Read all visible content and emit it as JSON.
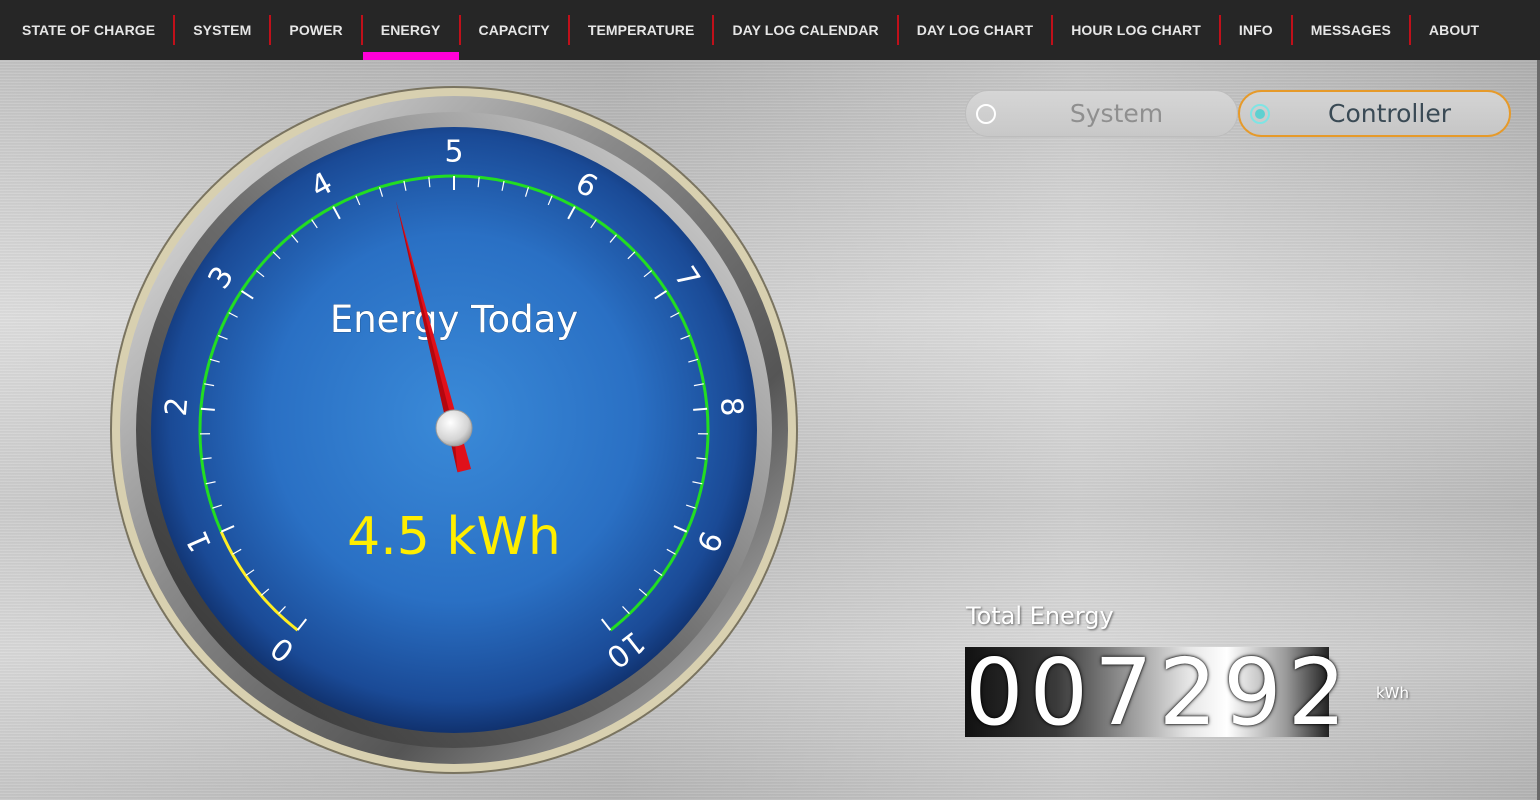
{
  "nav": {
    "tabs": [
      {
        "label": "STATE OF CHARGE"
      },
      {
        "label": "SYSTEM"
      },
      {
        "label": "POWER"
      },
      {
        "label": "ENERGY",
        "active": true
      },
      {
        "label": "CAPACITY"
      },
      {
        "label": "TEMPERATURE"
      },
      {
        "label": "DAY LOG CALENDAR"
      },
      {
        "label": "DAY LOG CHART"
      },
      {
        "label": "HOUR LOG CHART"
      },
      {
        "label": "INFO"
      },
      {
        "label": "MESSAGES"
      },
      {
        "label": "ABOUT"
      }
    ],
    "active_color": "#ff00d8",
    "separator_color": "#c0101a"
  },
  "toggle": {
    "system_label": "System",
    "controller_label": "Controller",
    "selected": "Controller"
  },
  "gauge": {
    "title": "Energy Today",
    "value_text": "4.5 kWh",
    "value": 4.5,
    "min": 0,
    "max": 10,
    "tick_labels": [
      "0",
      "1",
      "2",
      "3",
      "4",
      "5",
      "6",
      "7",
      "8",
      "9",
      "10"
    ],
    "low_zone": [
      0,
      1
    ],
    "normal_zone": [
      1,
      10
    ],
    "low_zone_color": "#ffee22",
    "normal_zone_color": "#22dd22",
    "needle_color": "#e0101a",
    "value_color": "#ffee00"
  },
  "total": {
    "label": "Total Energy",
    "value": "007292",
    "unit": "kWh"
  }
}
